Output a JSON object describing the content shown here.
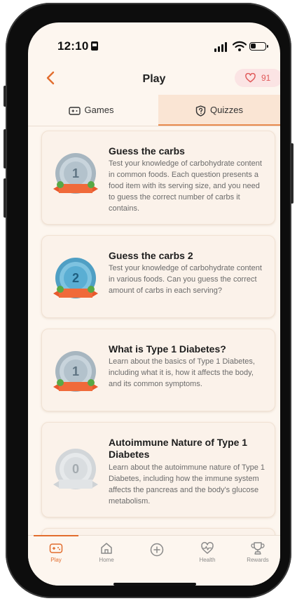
{
  "status_bar": {
    "time": "12:10"
  },
  "header": {
    "title": "Play",
    "back_icon": "chevron-left-icon",
    "hearts_count": "91",
    "accent": "#e26d2e"
  },
  "tabs": [
    {
      "label": "Games",
      "icon": "gamepad-icon",
      "selected": false
    },
    {
      "label": "Quizzes",
      "icon": "question-shield-icon",
      "selected": true
    }
  ],
  "quizzes": [
    {
      "badge_number": "1",
      "title": "Guess the carbs",
      "description": "Test your knowledge of carbohydrate content in common foods. Each question presents a food item with its serving size, and you need to guess the correct number of carbs it contains."
    },
    {
      "badge_number": "2",
      "title": "Guess the carbs 2",
      "description": "Test your knowledge of carbohydrate content in various foods. Can you guess the correct amount of carbs in each serving?"
    },
    {
      "badge_number": "1",
      "title": "What is Type 1 Diabetes?",
      "description": "Learn about the basics of Type 1 Diabetes, including what it is, how it affects the body, and its common symptoms."
    },
    {
      "badge_number": "0",
      "title": "Autoimmune Nature of Type 1 Diabetes",
      "description": "Learn about the autoimmune nature of Type 1 Diabetes, including how the immune system affects the pancreas and the body's glucose metabolism."
    }
  ],
  "tab_bar": [
    {
      "label": "Play",
      "icon": "gamepad-icon",
      "active": true
    },
    {
      "label": "Home",
      "icon": "home-icon",
      "active": false
    },
    {
      "label": "",
      "icon": "plus-circle-icon",
      "active": false
    },
    {
      "label": "Health",
      "icon": "heart-pulse-icon",
      "active": false
    },
    {
      "label": "Rewards",
      "icon": "trophy-icon",
      "active": false
    }
  ]
}
